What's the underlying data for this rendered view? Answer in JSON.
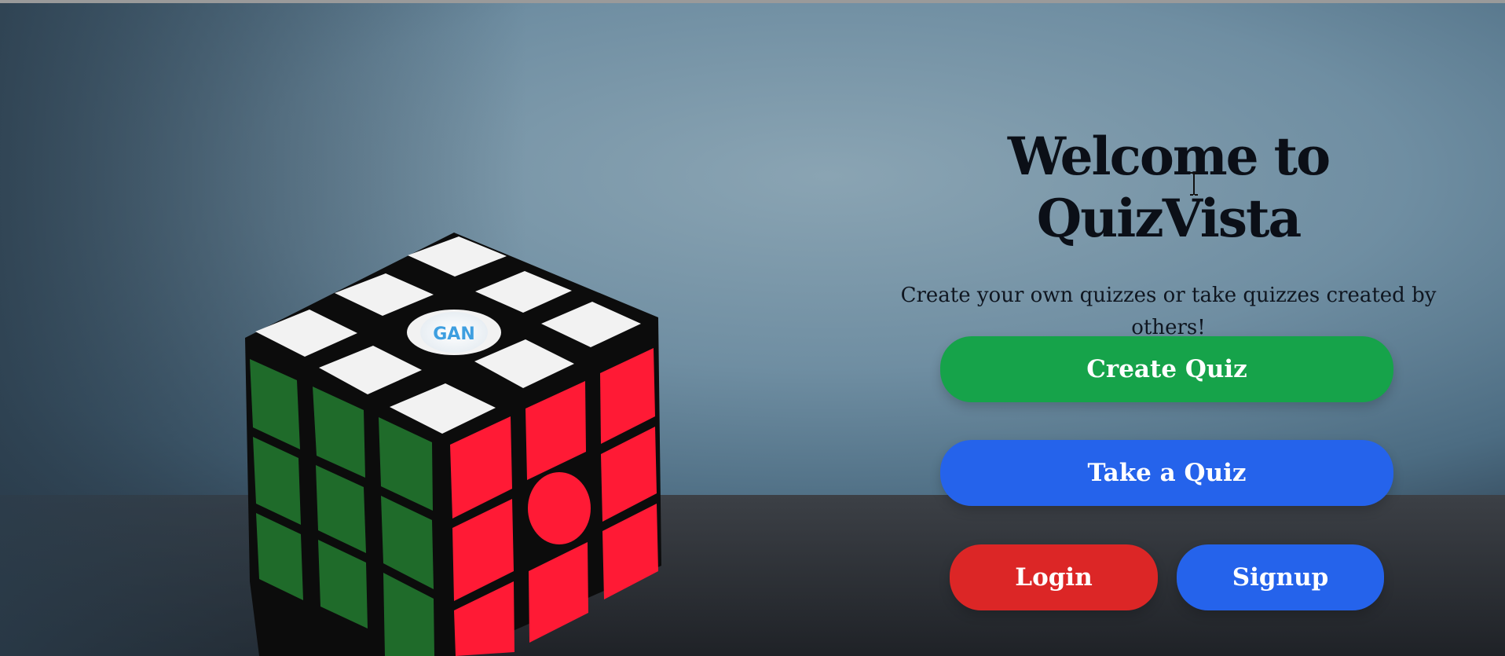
{
  "hero": {
    "title": "Welcome to QuizVista",
    "subtitle": "Create your own quizzes or take quizzes created by others!"
  },
  "actions": {
    "create_quiz": "Create Quiz",
    "take_quiz": "Take a Quiz",
    "login": "Login",
    "signup": "Signup"
  },
  "cube_logo": "GAN",
  "colors": {
    "create": "#16a34a",
    "take": "#2563eb",
    "login": "#dc2626",
    "signup": "#2563eb"
  },
  "icons": {
    "cursor": "text-cursor-icon"
  }
}
